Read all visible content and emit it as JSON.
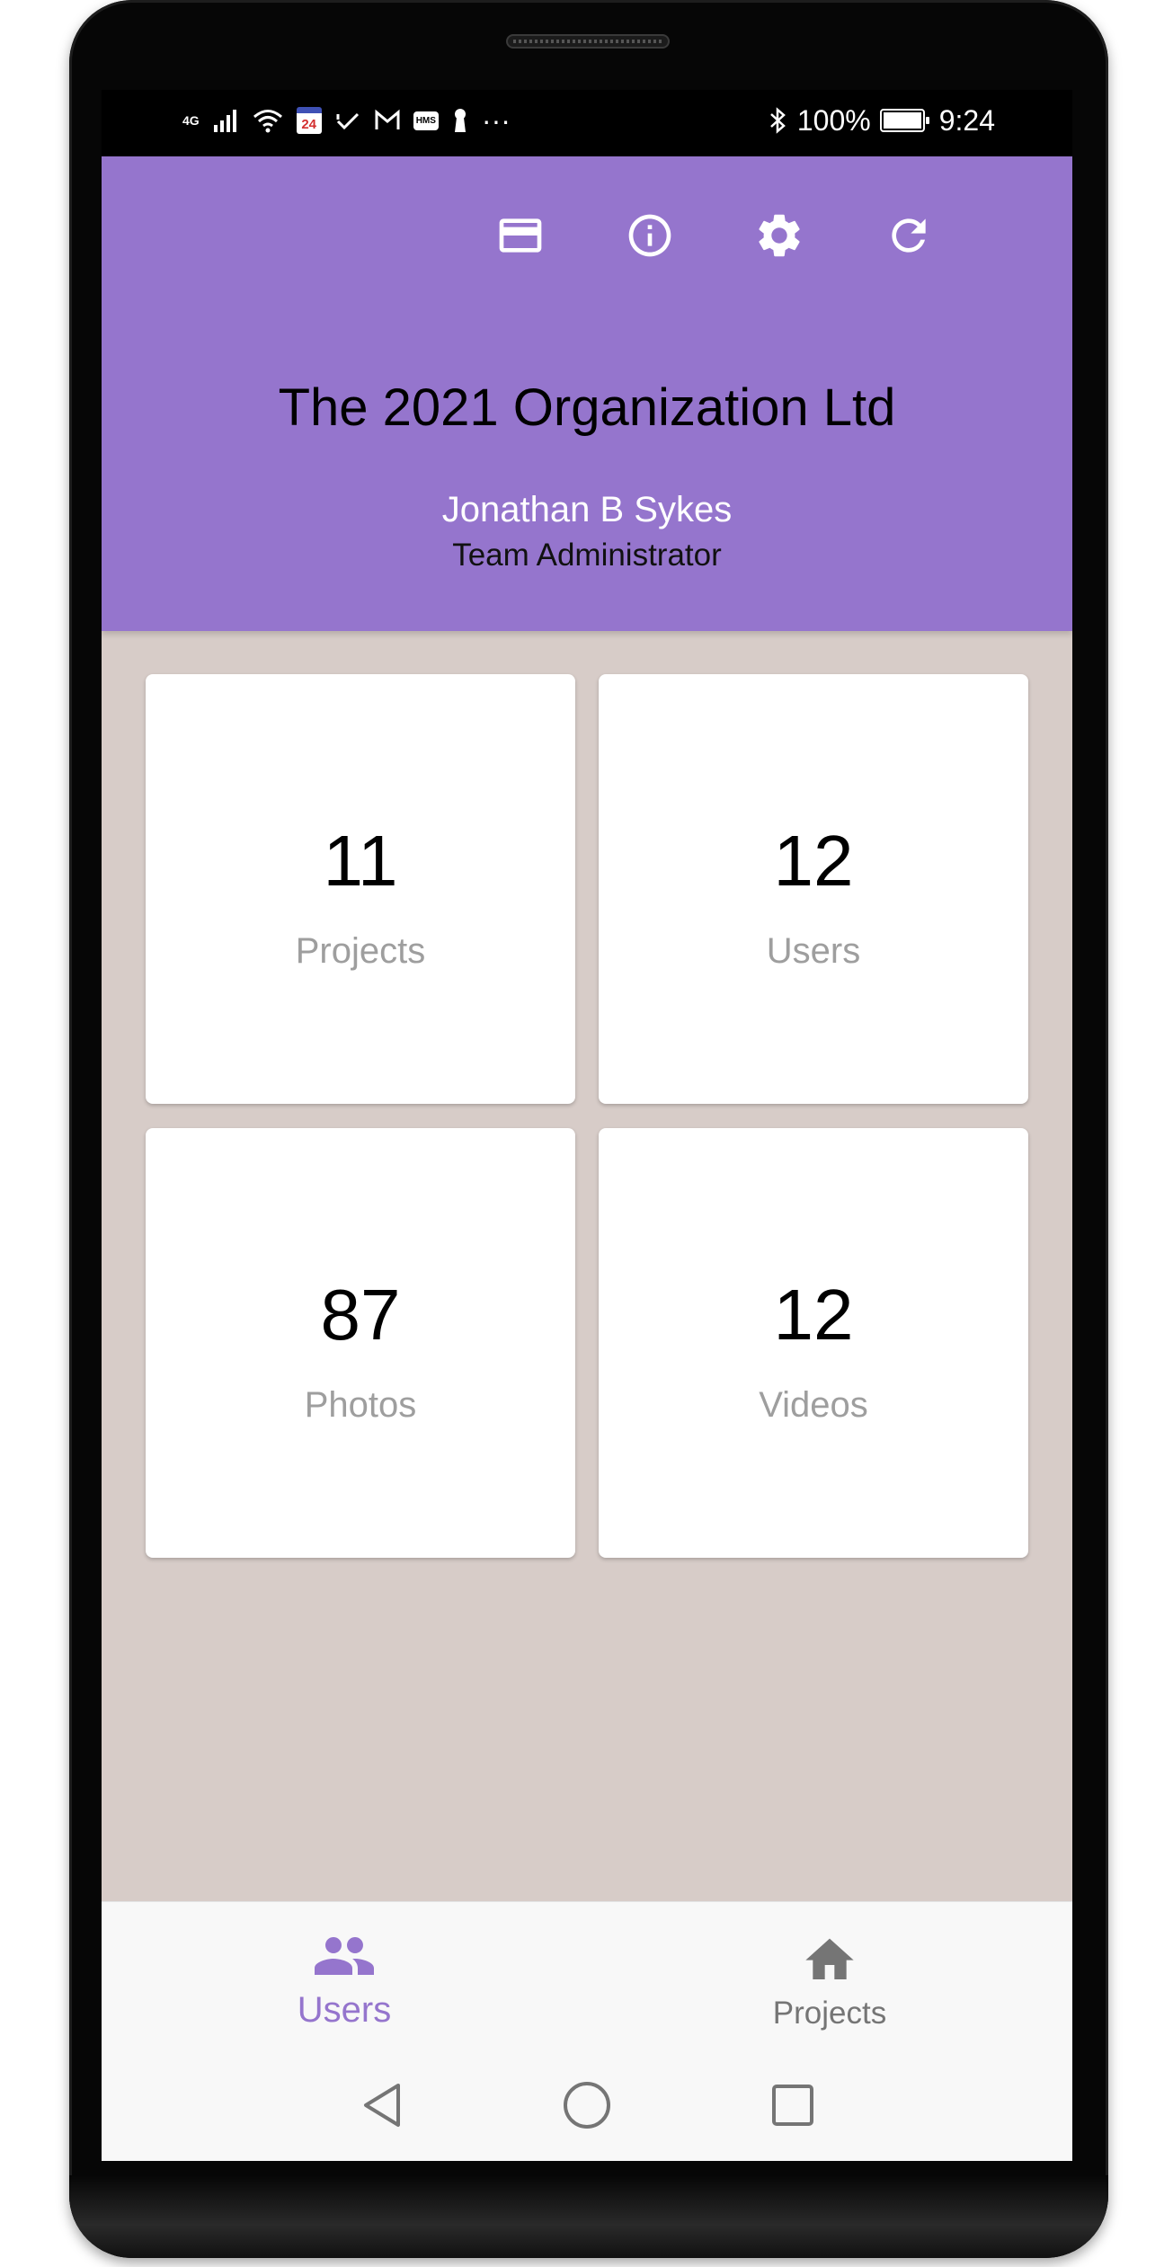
{
  "status_bar": {
    "network": "4G",
    "calendar_day": "24",
    "hms_badge": "HMS",
    "more": "···",
    "battery": "100%",
    "time": "9:24"
  },
  "header": {
    "background": "#9575cd",
    "org_title": "The 2021 Organization Ltd",
    "user_name": "Jonathan B Sykes",
    "user_role": "Team Administrator",
    "actions": [
      "credit-card-icon",
      "info-icon",
      "settings-icon",
      "refresh-icon"
    ]
  },
  "stats": [
    {
      "value": "11",
      "label": "Projects"
    },
    {
      "value": "12",
      "label": "Users"
    },
    {
      "value": "87",
      "label": "Photos"
    },
    {
      "value": "12",
      "label": "Videos"
    }
  ],
  "bottom_nav": {
    "items": [
      {
        "label": "Users",
        "icon": "people-icon",
        "active": true
      },
      {
        "label": "Projects",
        "icon": "home-icon",
        "active": false
      }
    ],
    "active_color": "#9575cd",
    "inactive_color": "#757575"
  },
  "system_nav": [
    "back-icon",
    "home-circle-icon",
    "recents-icon"
  ]
}
